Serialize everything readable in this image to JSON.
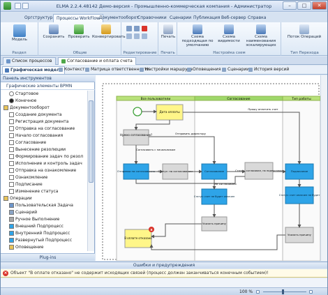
{
  "window": {
    "title": "ELMA 2.2.4.48142 Демо-версия - Промышленно-коммерческая компания - Администратор"
  },
  "ribbon_tabs": [
    "Оргструктура",
    "Процессы WorkFlow",
    "Документооборот",
    "Справочники",
    "Сценарии",
    "Публикация",
    "Веб-сервер",
    "Справка"
  ],
  "ribbon": {
    "groups": {
      "razdel": "Раздел",
      "obshie": "Общие",
      "redaktirovanie": "Редактирование",
      "pechat": "Печать",
      "nastroika": "Настройка схем",
      "tip_perehoda": "Тип Перехода"
    },
    "buttons": {
      "model": "Модель",
      "save": "Сохранить",
      "check": "Проверить",
      "convert": "Конвертировать",
      "print": "Печать",
      "default_scheme": "Схема подходящая по умолчанию",
      "visibility": "Схема видимости",
      "executors": "Схема наименования эскалирующих",
      "flow": "Поток Операций"
    }
  },
  "doc_tabs": [
    "Список процессов",
    "Согласование и оплата счета"
  ],
  "sub_tabs": [
    "Графическая модель",
    "Контекст",
    "Матрица ответственности",
    "Настройки маршрута",
    "Оповещения",
    "Сценарии",
    "История версий"
  ],
  "left_panel": {
    "title": "Панель инструментов",
    "subtitle": "Графические элементы BPMN",
    "items": [
      {
        "label": "Стартовое",
        "depth": 2,
        "icon": "start-event-icon"
      },
      {
        "label": "Конечное",
        "depth": 2,
        "icon": "end-event-icon"
      },
      {
        "label": "Документооборот",
        "depth": 1,
        "icon": "folder-icon"
      },
      {
        "label": "Создание документа",
        "depth": 2,
        "icon": "doc-icon"
      },
      {
        "label": "Регистрация документа",
        "depth": 2,
        "icon": "doc-icon"
      },
      {
        "label": "Отправка на согласование",
        "depth": 2,
        "icon": "doc-icon"
      },
      {
        "label": "Начало согласования",
        "depth": 2,
        "icon": "doc-icon"
      },
      {
        "label": "Согласование",
        "depth": 2,
        "icon": "doc-icon"
      },
      {
        "label": "Вынесение резолюции",
        "depth": 2,
        "icon": "doc-icon"
      },
      {
        "label": "Формирование задач по резол",
        "depth": 2,
        "icon": "doc-icon"
      },
      {
        "label": "Исполнение и контроль задач",
        "depth": 2,
        "icon": "doc-icon"
      },
      {
        "label": "Отправка на ознакомление",
        "depth": 2,
        "icon": "doc-icon"
      },
      {
        "label": "Ознакомление",
        "depth": 2,
        "icon": "doc-icon"
      },
      {
        "label": "Подписание",
        "depth": 2,
        "icon": "doc-icon"
      },
      {
        "label": "Изменение статуса",
        "depth": 2,
        "icon": "doc-icon"
      },
      {
        "label": "Операции",
        "depth": 1,
        "icon": "folder-icon"
      },
      {
        "label": "Пользовательская Задача",
        "depth": 2,
        "icon": "user-task-icon"
      },
      {
        "label": "Сценарий",
        "depth": 2,
        "icon": "script-icon"
      },
      {
        "label": "Ручное Выполнение",
        "depth": 2,
        "icon": "manual-icon"
      },
      {
        "label": "Внешний Подпроцесс",
        "depth": 2,
        "icon": "subprocess-icon"
      },
      {
        "label": "Внутренний Подпроцесс",
        "depth": 2,
        "icon": "subprocess-icon"
      },
      {
        "label": "Развернутый Подпроцесс",
        "depth": 2,
        "icon": "subprocess-icon"
      },
      {
        "label": "Оповещение",
        "depth": 2,
        "icon": "notify-icon"
      }
    ],
    "plugins": "Plug-ins"
  },
  "diagram": {
    "lanes": [
      "Все пользователи",
      "Согласование",
      "Тип работы"
    ],
    "nodes": {
      "data_oplaty": "Дата оплаты",
      "nuzhno_soglasovanie": "Нужно согласование?",
      "otpravka": "Отправка на согласование",
      "status_na_soglasovanii": "Статус: на согласовании",
      "soglasovanie": "Согласование",
      "status_soglasovan": "Статус: согласован, на подписании",
      "podpisanie": "Подписание",
      "status_schet_ne_oplachen": "Статус: счет не будет оплачен",
      "ukazat_prichinu_1": "Указать причину",
      "status_schet_oplachen": "Статус: счет оплачен не будет",
      "ukazat_prichinu_2": "Указать причину",
      "v_oplate_otkazano": "В оплате отказано"
    },
    "edge_labels": {
      "prosh_oplatit": "Прошу оплатить счет",
      "otpravit_direktoru": "Отправить директору",
      "soglasovat_s_nachalnikom": "Согласовать с начальником",
      "ne_soglasovan": "Не согласовано"
    }
  },
  "errors": {
    "header": "Ошибки и предупреждения",
    "message": "Объект \"В оплате отказано\" не содержит исходящих связей (процесс должен заканчиваться конечным событием)!"
  },
  "status": {
    "zoom": "100 %"
  }
}
